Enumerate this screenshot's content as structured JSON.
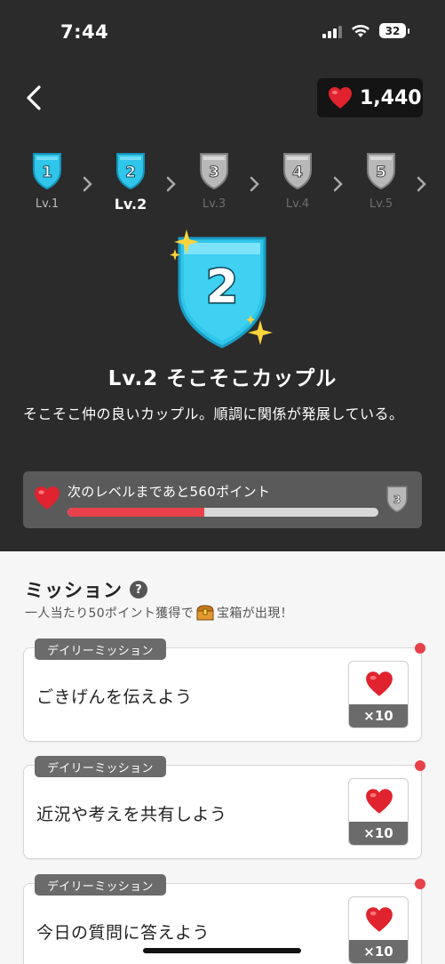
{
  "status": {
    "time": "7:44",
    "battery": "32"
  },
  "header": {
    "hearts": "1,440"
  },
  "levels": [
    {
      "label": "Lv.1",
      "num": "1",
      "state": "done"
    },
    {
      "label": "Lv.2",
      "num": "2",
      "state": "current"
    },
    {
      "label": "Lv.3",
      "num": "3",
      "state": "locked"
    },
    {
      "label": "Lv.4",
      "num": "4",
      "state": "locked"
    },
    {
      "label": "Lv.5",
      "num": "5",
      "state": "locked"
    }
  ],
  "current": {
    "badge_num": "2",
    "title": "Lv.2  そこそこカップル",
    "description": "そこそこ仲の良いカップル。順調に関係が発展している。"
  },
  "progress": {
    "text": "次のレベルまであと560ポイント",
    "fraction": 0.44,
    "next_num": "3"
  },
  "missions": {
    "title": "ミッション",
    "help": "?",
    "sub_before": "一人当たり50ポイント獲得で",
    "sub_after": "宝箱が出現！",
    "items": [
      {
        "tag": "デイリーミッション",
        "text": "ごきげんを伝えよう",
        "reward": "×10"
      },
      {
        "tag": "デイリーミッション",
        "text": "近況や考えを共有しよう",
        "reward": "×10"
      },
      {
        "tag": "デイリーミッション",
        "text": "今日の質問に答えよう",
        "reward": "×10"
      }
    ]
  },
  "colors": {
    "accent": "#e8414a",
    "badge_blue": "#2fc6ea",
    "dark_bg": "#2b2b2b"
  }
}
